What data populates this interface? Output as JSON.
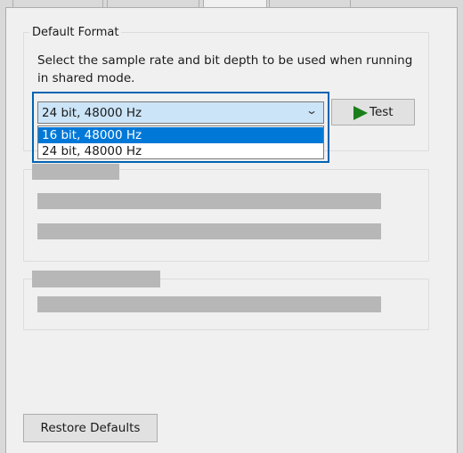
{
  "tabs": [
    "",
    "",
    "",
    ""
  ],
  "default_format": {
    "legend": "Default Format",
    "description": "Select the sample rate and bit depth to be used when running in shared mode.",
    "selected_value": "24 bit, 48000 Hz",
    "options": [
      {
        "label": "16 bit, 48000 Hz",
        "highlighted": true
      },
      {
        "label": "24 bit, 48000 Hz",
        "highlighted": false
      }
    ],
    "test_button": "Test"
  },
  "restore_defaults_button": "Restore Defaults",
  "colors": {
    "selection": "#0078d7",
    "focus_border": "#0063b1",
    "play_icon": "#1a7f1a",
    "redacted_bar": "#b7b7b7"
  },
  "icons": {
    "dropdown": "chevron-down-icon",
    "test": "play-icon"
  }
}
